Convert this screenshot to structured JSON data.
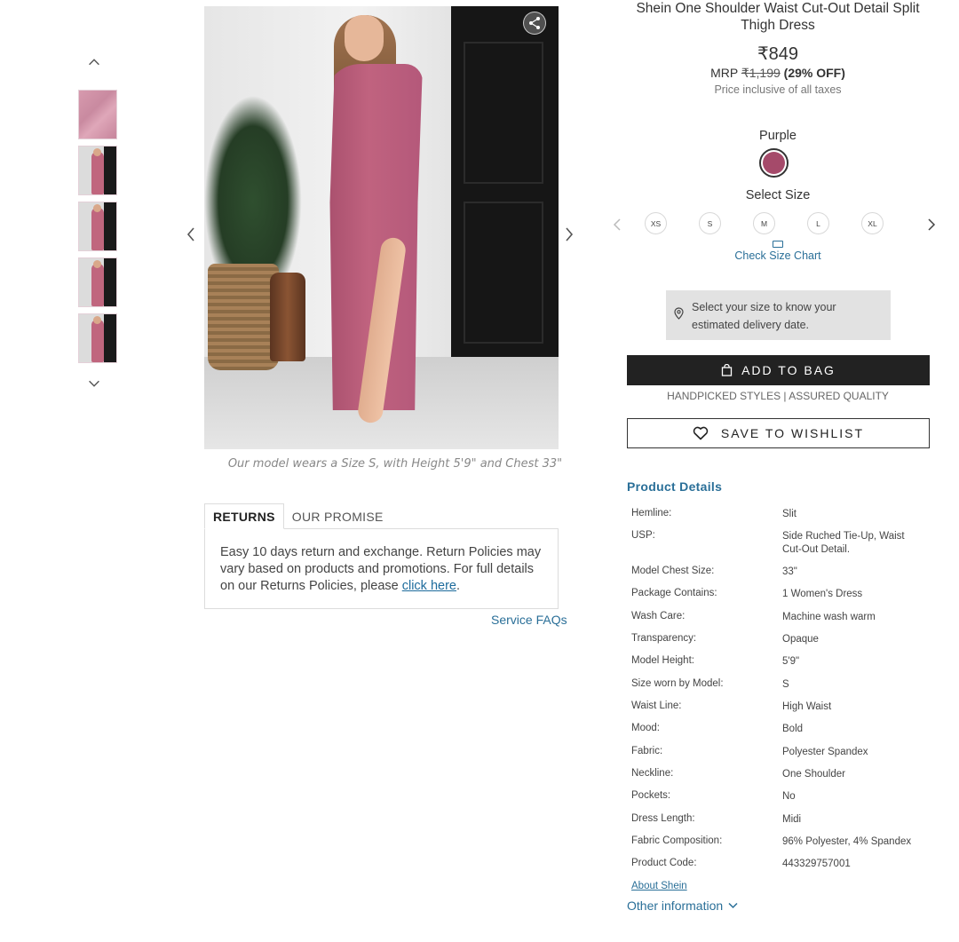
{
  "product": {
    "title": "Shein One Shoulder Waist Cut-Out Detail Split Thigh Dress",
    "price": "₹849",
    "mrp_label": "MRP",
    "mrp_value": "₹1,199",
    "discount": "(29% OFF)",
    "tax_note": "Price inclusive of all taxes",
    "color_name": "Purple",
    "swatch_color": "#a54a6a"
  },
  "gallery": {
    "caption": "Our model wears a Size S, with Height 5'9\" and Chest 33\"",
    "thumbnail_count": 5
  },
  "sizes": {
    "label": "Select Size",
    "options": [
      "XS",
      "S",
      "M",
      "L",
      "XL"
    ],
    "size_chart_label": "Check Size Chart"
  },
  "delivery": {
    "message": "Select your size to know your estimated delivery date."
  },
  "actions": {
    "add_to_bag": "ADD TO BAG",
    "tagline": "HANDPICKED STYLES | ASSURED QUALITY",
    "wishlist": "SAVE TO WISHLIST"
  },
  "returns": {
    "tabs": [
      "RETURNS",
      "OUR PROMISE"
    ],
    "text": "Easy 10 days return and exchange. Return Policies may vary based on products and promotions. For full details on our Returns Policies, please ",
    "link": "click here",
    "suffix": ".",
    "service_faqs": "Service FAQs"
  },
  "details": {
    "title": "Product Details",
    "rows": [
      {
        "k": "Hemline:",
        "v": "Slit"
      },
      {
        "k": "USP:",
        "v": "Side Ruched Tie-Up, Waist Cut-Out Detail."
      },
      {
        "k": "Model Chest Size:",
        "v": "33\""
      },
      {
        "k": "Package Contains:",
        "v": "1 Women's Dress"
      },
      {
        "k": "Wash Care:",
        "v": "Machine wash warm"
      },
      {
        "k": "Transparency:",
        "v": "Opaque"
      },
      {
        "k": "Model Height:",
        "v": "5'9\""
      },
      {
        "k": "Size worn by Model:",
        "v": "S"
      },
      {
        "k": "Waist Line:",
        "v": "High Waist"
      },
      {
        "k": "Mood:",
        "v": "Bold"
      },
      {
        "k": "Fabric:",
        "v": "Polyester Spandex"
      },
      {
        "k": "Neckline:",
        "v": "One Shoulder"
      },
      {
        "k": "Pockets:",
        "v": "No"
      },
      {
        "k": "Dress Length:",
        "v": "Midi"
      },
      {
        "k": "Fabric Composition:",
        "v": "96% Polyester, 4% Spandex"
      },
      {
        "k": "Product Code:",
        "v": "443329757001"
      }
    ],
    "about_link": "About Shein",
    "other_info": "Other information"
  },
  "colors": {
    "accent_blue": "#2a6f98",
    "button_dark": "#222222"
  }
}
